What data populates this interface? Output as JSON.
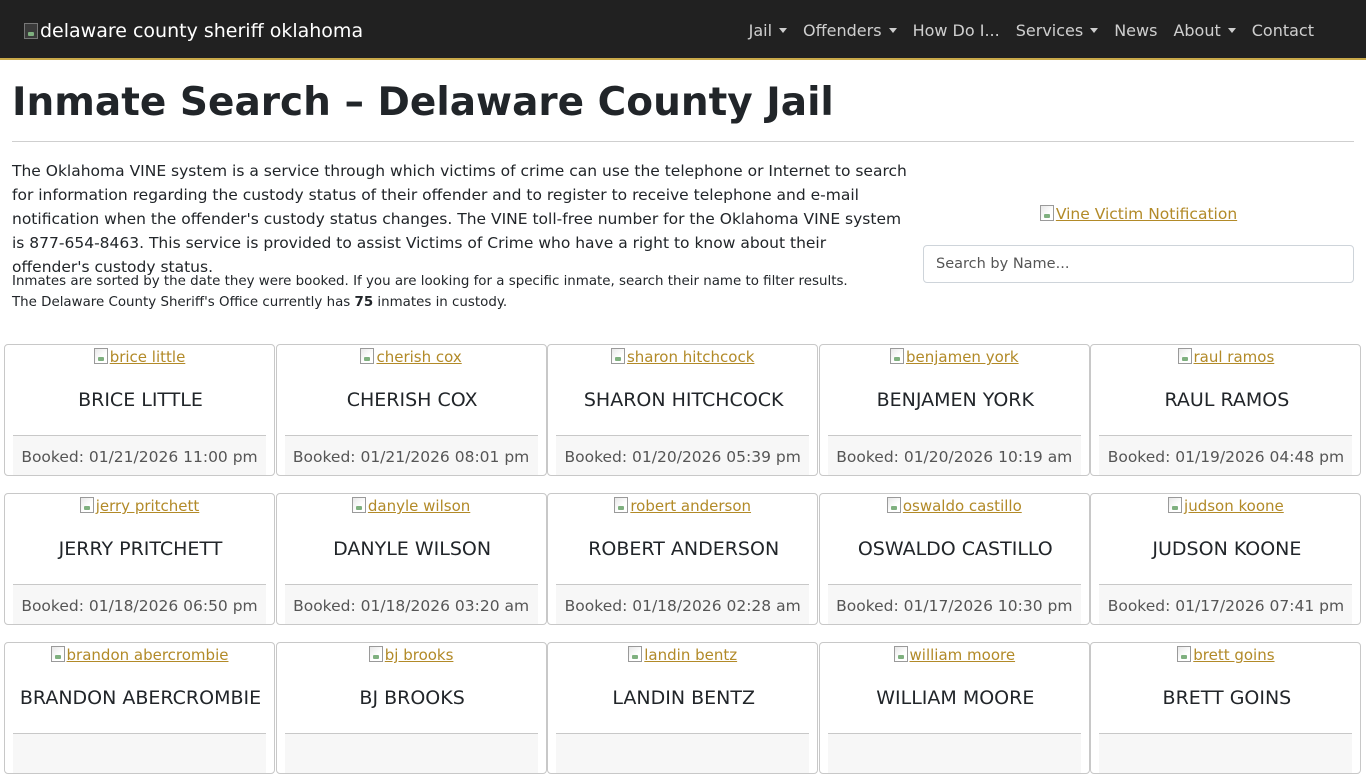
{
  "nav": {
    "brand_alt": "delaware county sheriff oklahoma",
    "items": [
      {
        "label": "Jail",
        "dropdown": true
      },
      {
        "label": "Offenders",
        "dropdown": true
      },
      {
        "label": "How Do I...",
        "dropdown": false
      },
      {
        "label": "Services",
        "dropdown": true
      },
      {
        "label": "News",
        "dropdown": false
      },
      {
        "label": "About",
        "dropdown": true
      },
      {
        "label": "Contact",
        "dropdown": false
      }
    ]
  },
  "page": {
    "title": "Inmate Search – Delaware County Jail",
    "intro": "The Oklahoma VINE system is a service through which victims of crime can use the telephone or Internet to search for information regarding the custody status of their offender and to register to receive telephone and e-mail notification when the offender's custody status changes. The VINE toll-free number for the Oklahoma VINE system is 877-654-8463. This service is provided to assist Victims of Crime who have a right to know about their offender's custody status.",
    "note_line1": "Inmates are sorted by the date they were booked. If you are looking for a specific inmate, search their name to filter results.",
    "note_line2_prefix": "The Delaware County Sheriff's Office currently has ",
    "inmate_count": "75",
    "note_line2_suffix": " inmates in custody.",
    "vine_alt": "Vine Victim Notification",
    "search_placeholder": "Search by Name..."
  },
  "colors": {
    "navbar_bg": "#212121",
    "navbar_accent": "#c9a94a",
    "link": "#b28a28"
  },
  "inmates": [
    {
      "alt": "brice little",
      "name": "BRICE LITTLE",
      "booked": "Booked: 01/21/2026 11:00 pm"
    },
    {
      "alt": "cherish cox",
      "name": "CHERISH COX",
      "booked": "Booked: 01/21/2026 08:01 pm"
    },
    {
      "alt": "sharon hitchcock",
      "name": "SHARON HITCHCOCK",
      "booked": "Booked: 01/20/2026 05:39 pm"
    },
    {
      "alt": "benjamen york",
      "name": "BENJAMEN YORK",
      "booked": "Booked: 01/20/2026 10:19 am"
    },
    {
      "alt": "raul ramos",
      "name": "RAUL RAMOS",
      "booked": "Booked: 01/19/2026 04:48 pm"
    },
    {
      "alt": "jerry pritchett",
      "name": "JERRY PRITCHETT",
      "booked": "Booked: 01/18/2026 06:50 pm"
    },
    {
      "alt": "danyle wilson",
      "name": "DANYLE WILSON",
      "booked": "Booked: 01/18/2026 03:20 am"
    },
    {
      "alt": "robert anderson",
      "name": "ROBERT ANDERSON",
      "booked": "Booked: 01/18/2026 02:28 am"
    },
    {
      "alt": "oswaldo castillo",
      "name": "OSWALDO CASTILLO",
      "booked": "Booked: 01/17/2026 10:30 pm"
    },
    {
      "alt": "judson koone",
      "name": "JUDSON KOONE",
      "booked": "Booked: 01/17/2026 07:41 pm"
    },
    {
      "alt": "brandon abercrombie",
      "name": "BRANDON ABERCROMBIE",
      "booked": ""
    },
    {
      "alt": "bj brooks",
      "name": "BJ BROOKS",
      "booked": ""
    },
    {
      "alt": "landin bentz",
      "name": "LANDIN BENTZ",
      "booked": ""
    },
    {
      "alt": "william moore",
      "name": "WILLIAM MOORE",
      "booked": ""
    },
    {
      "alt": "brett goins",
      "name": "BRETT GOINS",
      "booked": ""
    }
  ]
}
